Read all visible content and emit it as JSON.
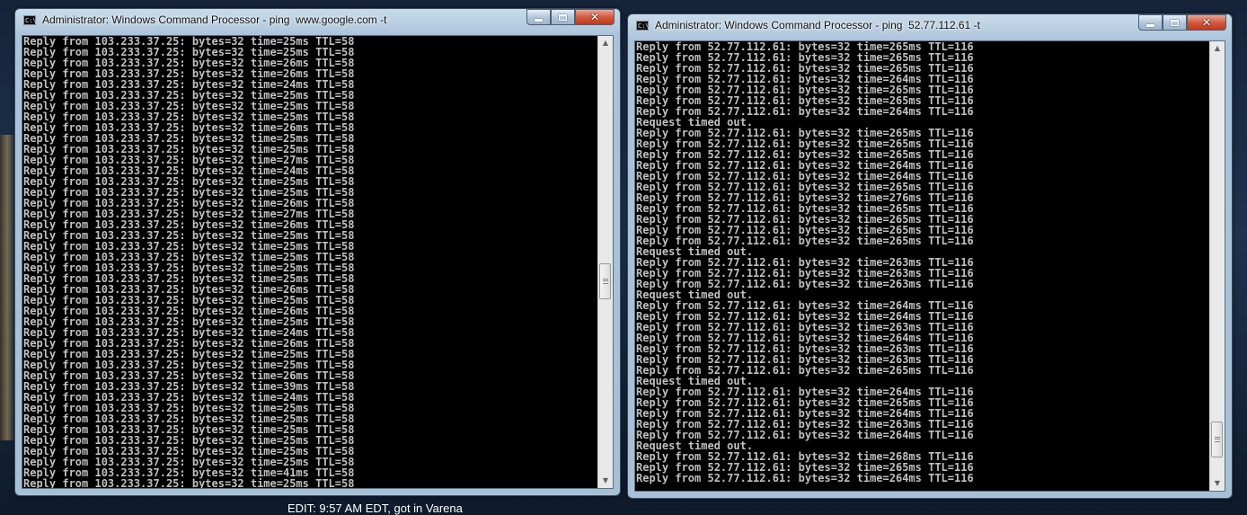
{
  "edit_note": "EDIT: 9:57 AM EDT, got in Varena",
  "left_window": {
    "icon_label": "C:\\",
    "title": "Administrator: Windows Command Processor - ping  www.google.com -t",
    "lines": [
      "Reply from 103.233.37.25: bytes=32 time=25ms TTL=58",
      "Reply from 103.233.37.25: bytes=32 time=25ms TTL=58",
      "Reply from 103.233.37.25: bytes=32 time=26ms TTL=58",
      "Reply from 103.233.37.25: bytes=32 time=26ms TTL=58",
      "Reply from 103.233.37.25: bytes=32 time=24ms TTL=58",
      "Reply from 103.233.37.25: bytes=32 time=25ms TTL=58",
      "Reply from 103.233.37.25: bytes=32 time=25ms TTL=58",
      "Reply from 103.233.37.25: bytes=32 time=25ms TTL=58",
      "Reply from 103.233.37.25: bytes=32 time=26ms TTL=58",
      "Reply from 103.233.37.25: bytes=32 time=25ms TTL=58",
      "Reply from 103.233.37.25: bytes=32 time=25ms TTL=58",
      "Reply from 103.233.37.25: bytes=32 time=27ms TTL=58",
      "Reply from 103.233.37.25: bytes=32 time=24ms TTL=58",
      "Reply from 103.233.37.25: bytes=32 time=25ms TTL=58",
      "Reply from 103.233.37.25: bytes=32 time=25ms TTL=58",
      "Reply from 103.233.37.25: bytes=32 time=26ms TTL=58",
      "Reply from 103.233.37.25: bytes=32 time=27ms TTL=58",
      "Reply from 103.233.37.25: bytes=32 time=26ms TTL=58",
      "Reply from 103.233.37.25: bytes=32 time=25ms TTL=58",
      "Reply from 103.233.37.25: bytes=32 time=25ms TTL=58",
      "Reply from 103.233.37.25: bytes=32 time=25ms TTL=58",
      "Reply from 103.233.37.25: bytes=32 time=25ms TTL=58",
      "Reply from 103.233.37.25: bytes=32 time=25ms TTL=58",
      "Reply from 103.233.37.25: bytes=32 time=26ms TTL=58",
      "Reply from 103.233.37.25: bytes=32 time=25ms TTL=58",
      "Reply from 103.233.37.25: bytes=32 time=26ms TTL=58",
      "Reply from 103.233.37.25: bytes=32 time=25ms TTL=58",
      "Reply from 103.233.37.25: bytes=32 time=24ms TTL=58",
      "Reply from 103.233.37.25: bytes=32 time=26ms TTL=58",
      "Reply from 103.233.37.25: bytes=32 time=25ms TTL=58",
      "Reply from 103.233.37.25: bytes=32 time=25ms TTL=58",
      "Reply from 103.233.37.25: bytes=32 time=26ms TTL=58",
      "Reply from 103.233.37.25: bytes=32 time=39ms TTL=58",
      "Reply from 103.233.37.25: bytes=32 time=24ms TTL=58",
      "Reply from 103.233.37.25: bytes=32 time=25ms TTL=58",
      "Reply from 103.233.37.25: bytes=32 time=25ms TTL=58",
      "Reply from 103.233.37.25: bytes=32 time=25ms TTL=58",
      "Reply from 103.233.37.25: bytes=32 time=25ms TTL=58",
      "Reply from 103.233.37.25: bytes=32 time=25ms TTL=58",
      "Reply from 103.233.37.25: bytes=32 time=25ms TTL=58",
      "Reply from 103.233.37.25: bytes=32 time=41ms TTL=58",
      "Reply from 103.233.37.25: bytes=32 time=25ms TTL=58"
    ]
  },
  "right_window": {
    "icon_label": "C:\\",
    "title": "Administrator: Windows Command Processor - ping  52.77.112.61 -t",
    "lines": [
      "Reply from 52.77.112.61: bytes=32 time=265ms TTL=116",
      "Reply from 52.77.112.61: bytes=32 time=265ms TTL=116",
      "Reply from 52.77.112.61: bytes=32 time=265ms TTL=116",
      "Reply from 52.77.112.61: bytes=32 time=264ms TTL=116",
      "Reply from 52.77.112.61: bytes=32 time=265ms TTL=116",
      "Reply from 52.77.112.61: bytes=32 time=265ms TTL=116",
      "Reply from 52.77.112.61: bytes=32 time=264ms TTL=116",
      "Request timed out.",
      "Reply from 52.77.112.61: bytes=32 time=265ms TTL=116",
      "Reply from 52.77.112.61: bytes=32 time=265ms TTL=116",
      "Reply from 52.77.112.61: bytes=32 time=265ms TTL=116",
      "Reply from 52.77.112.61: bytes=32 time=264ms TTL=116",
      "Reply from 52.77.112.61: bytes=32 time=264ms TTL=116",
      "Reply from 52.77.112.61: bytes=32 time=265ms TTL=116",
      "Reply from 52.77.112.61: bytes=32 time=276ms TTL=116",
      "Reply from 52.77.112.61: bytes=32 time=265ms TTL=116",
      "Reply from 52.77.112.61: bytes=32 time=265ms TTL=116",
      "Reply from 52.77.112.61: bytes=32 time=265ms TTL=116",
      "Reply from 52.77.112.61: bytes=32 time=265ms TTL=116",
      "Request timed out.",
      "Reply from 52.77.112.61: bytes=32 time=263ms TTL=116",
      "Reply from 52.77.112.61: bytes=32 time=263ms TTL=116",
      "Reply from 52.77.112.61: bytes=32 time=263ms TTL=116",
      "Request timed out.",
      "Reply from 52.77.112.61: bytes=32 time=264ms TTL=116",
      "Reply from 52.77.112.61: bytes=32 time=264ms TTL=116",
      "Reply from 52.77.112.61: bytes=32 time=263ms TTL=116",
      "Reply from 52.77.112.61: bytes=32 time=264ms TTL=116",
      "Reply from 52.77.112.61: bytes=32 time=263ms TTL=116",
      "Reply from 52.77.112.61: bytes=32 time=263ms TTL=116",
      "Reply from 52.77.112.61: bytes=32 time=265ms TTL=116",
      "Request timed out.",
      "Reply from 52.77.112.61: bytes=32 time=264ms TTL=116",
      "Reply from 52.77.112.61: bytes=32 time=265ms TTL=116",
      "Reply from 52.77.112.61: bytes=32 time=264ms TTL=116",
      "Reply from 52.77.112.61: bytes=32 time=263ms TTL=116",
      "Reply from 52.77.112.61: bytes=32 time=264ms TTL=116",
      "Request timed out.",
      "Reply from 52.77.112.61: bytes=32 time=268ms TTL=116",
      "Reply from 52.77.112.61: bytes=32 time=265ms TTL=116",
      "Reply from 52.77.112.61: bytes=32 time=264ms TTL=116"
    ]
  },
  "icons": {
    "app": "cmd-icon",
    "minimize": "minimize-icon",
    "maximize": "maximize-icon",
    "close": "close-icon",
    "close_glyph": "✕",
    "scroll_up": "▲",
    "scroll_down": "▼"
  },
  "scroll": {
    "left_position": 0.55,
    "right_position": 0.95
  },
  "colors": {
    "console_background": "#000000",
    "console_text": "#c0c0c0",
    "close_button": "#c0381c"
  }
}
